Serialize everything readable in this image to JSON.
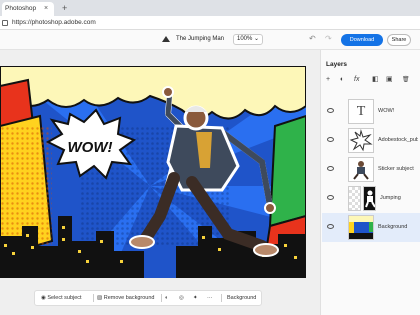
{
  "browser": {
    "tab_title": "Photoshop",
    "tab_close": "×",
    "new_tab": "+",
    "url": "https://photoshop.adobe.com",
    "back": "←",
    "forward": "→",
    "reload": "↻"
  },
  "toolbar": {
    "document_title": "The Jumping Man",
    "zoom": "100%",
    "undo": "↶",
    "redo": "↷",
    "download_label": "Download",
    "share_label": "Share"
  },
  "canvas": {
    "speech_text": "WOW!"
  },
  "bottom_bar": {
    "select_subject": "Select subject",
    "remove_background": "Remove background",
    "more": "···",
    "background": "Background"
  },
  "layers_panel": {
    "title": "Layers",
    "tools": [
      "+",
      "◐",
      "fx",
      "◧",
      "▣",
      "🗑"
    ],
    "layers": [
      {
        "name": "WOW!",
        "thumb": "text",
        "selected": false
      },
      {
        "name": "Adobestock_pub",
        "thumb": "burst",
        "selected": false
      },
      {
        "name": "Sticker subject",
        "thumb": "subject",
        "selected": false
      },
      {
        "name": "Jumping",
        "thumb": "mask",
        "selected": false
      },
      {
        "name": "Background",
        "thumb": "background",
        "selected": true
      }
    ]
  },
  "colors": {
    "accent": "#1473e6",
    "selected_layer": "#e3ecfa"
  }
}
